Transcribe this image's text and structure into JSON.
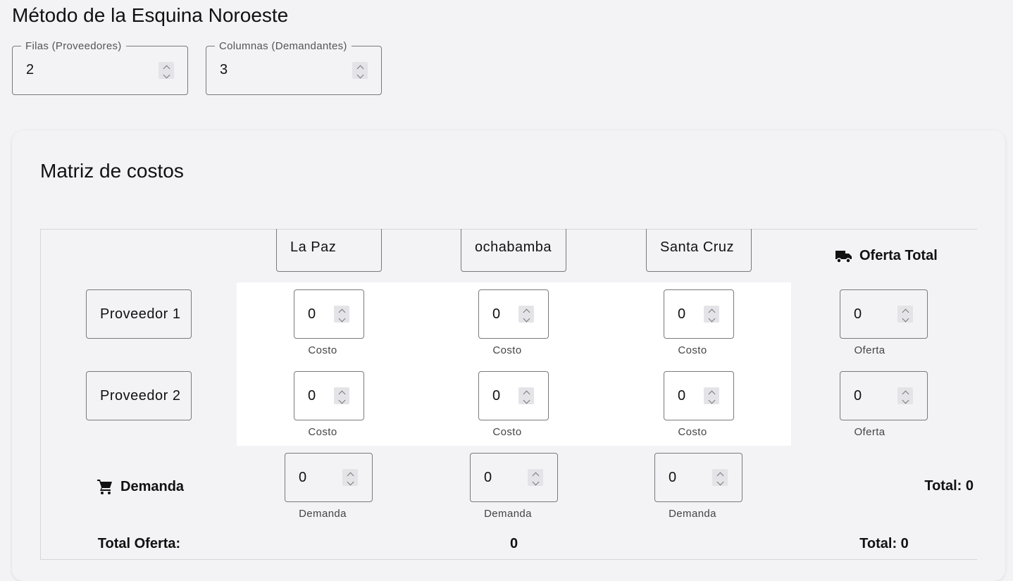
{
  "page_title": "Método de la Esquina Noroeste",
  "fields": {
    "rows": {
      "label": "Filas (Proveedores)",
      "value": "2"
    },
    "cols": {
      "label": "Columnas (Demandantes)",
      "value": "3"
    }
  },
  "card": {
    "title": "Matriz de costos",
    "destinations": [
      "La Paz",
      "ochabamba",
      "Santa Cruz"
    ],
    "offer_header": "Oferta Total",
    "providers": [
      {
        "name": "Proveedor 1",
        "costs": [
          "0",
          "0",
          "0"
        ],
        "offer": "0"
      },
      {
        "name": "Proveedor 2",
        "costs": [
          "0",
          "0",
          "0"
        ],
        "offer": "0"
      }
    ],
    "cost_caption": "Costo",
    "offer_caption": "Oferta",
    "demand_label": "Demanda",
    "demands": [
      "0",
      "0",
      "0"
    ],
    "demand_caption": "Demanda",
    "demand_total": "Total: 0",
    "total_offer_label": "Total Oferta:",
    "total_offer_value": "0",
    "grand_total": "Total: 0"
  },
  "icons": {
    "offer": "truck-icon",
    "demand": "cart-icon"
  }
}
